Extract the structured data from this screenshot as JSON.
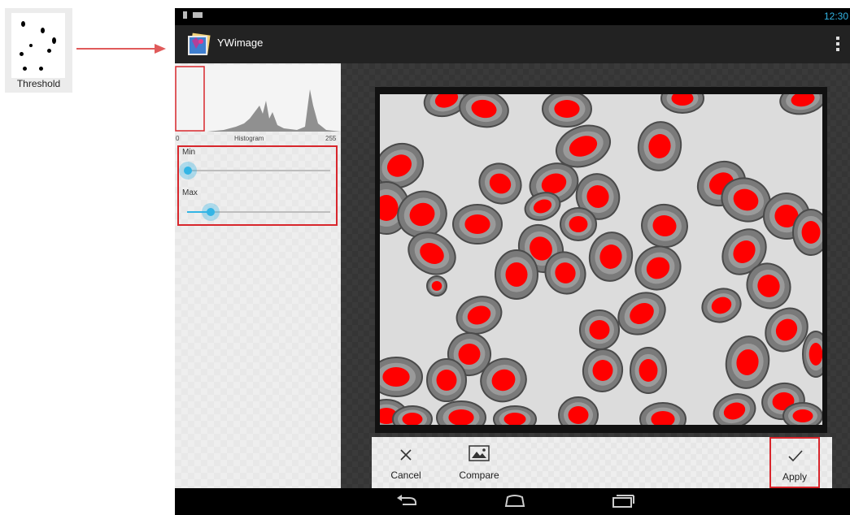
{
  "tool": {
    "label": "Threshold",
    "icon": "threshold-dots-icon"
  },
  "statusbar": {
    "time": "12:30"
  },
  "app": {
    "title": "YWimage",
    "logo": "app-photo-logo"
  },
  "histogram": {
    "title": "Histogram",
    "min_tick": "0",
    "max_tick": "255"
  },
  "threshold": {
    "min_label": "Min",
    "max_label": "Max",
    "min_value": 0.0,
    "max_value": 0.16
  },
  "toolbar": {
    "cancel_label": "Cancel",
    "compare_label": "Compare",
    "apply_label": "Apply"
  },
  "colors": {
    "accent": "#33b5e5",
    "highlight": "#d8262c",
    "threshold_overlay": "#ff0000"
  },
  "navbar": {
    "icons": [
      "back-icon",
      "home-icon",
      "recent-apps-icon"
    ]
  }
}
